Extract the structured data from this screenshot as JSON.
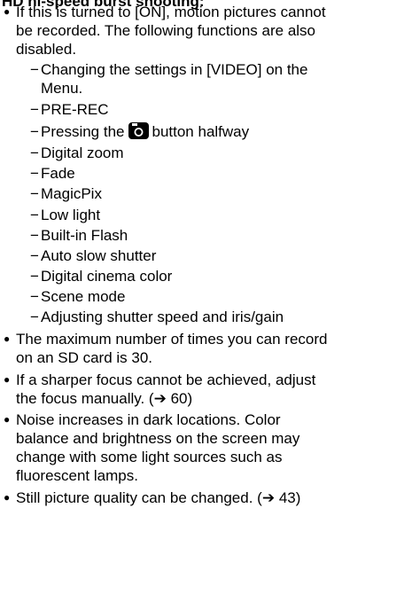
{
  "heading": "HD hi-speed burst shooting:",
  "bullet_glyph": "●",
  "dash_glyph": "−",
  "intro_lines": [
    "If this is turned to [ON], motion pictures cannot",
    "be recorded. The following functions are also",
    "disabled."
  ],
  "disabled_items": {
    "video_menu_line1": "Changing the settings in [VIDEO] on the",
    "video_menu_line2": "Menu.",
    "pre_rec": "PRE-REC",
    "pressing_before": "Pressing the",
    "pressing_after": "button halfway",
    "digital_zoom": "Digital zoom",
    "fade": "Fade",
    "magicpix": "MagicPix",
    "low_light": "Low light",
    "flash": "Built-in Flash",
    "auto_slow": "Auto slow shutter",
    "cinema_color": "Digital cinema color",
    "scene_mode": "Scene mode",
    "shutter_iris": "Adjusting shutter speed and iris/gain"
  },
  "notes": {
    "max_record_line1": "The maximum number of times you can record",
    "max_record_line2": "on an SD card is 30.",
    "focus_line1": "If a sharper focus cannot be achieved, adjust",
    "focus_line2_text": "the focus manually. (",
    "focus_line2_ref": "60)",
    "noise_line1": "Noise increases in dark locations. Color",
    "noise_line2": "balance and brightness on the screen may",
    "noise_line3": "change with some light sources such as",
    "noise_line4": "fluorescent lamps.",
    "quality_text": "Still picture quality can be changed. (",
    "quality_ref": "43)"
  },
  "arrow_glyph": "➔",
  "icons": [
    "camera-icon",
    "arrow-icon"
  ]
}
